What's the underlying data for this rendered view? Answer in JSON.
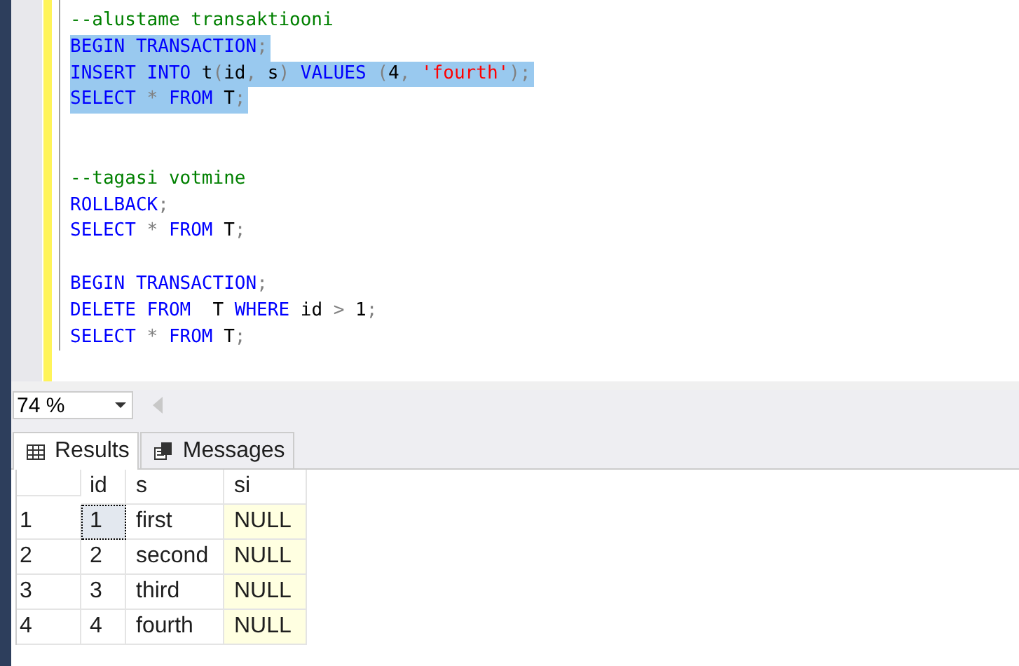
{
  "editor": {
    "lines": [
      {
        "selected": false,
        "tokens": [
          {
            "kind": "comment",
            "text": "--alustame transaktiooni"
          }
        ]
      },
      {
        "selected": true,
        "tokens": [
          {
            "kind": "keyword",
            "text": "BEGIN TRANSACTION"
          },
          {
            "kind": "operator",
            "text": ";"
          }
        ]
      },
      {
        "selected": true,
        "tokens": [
          {
            "kind": "keyword",
            "text": "INSERT INTO "
          },
          {
            "kind": "plain",
            "text": "t"
          },
          {
            "kind": "operator",
            "text": "("
          },
          {
            "kind": "plain",
            "text": "id"
          },
          {
            "kind": "operator",
            "text": ", "
          },
          {
            "kind": "plain",
            "text": "s"
          },
          {
            "kind": "operator",
            "text": ") "
          },
          {
            "kind": "keyword",
            "text": "VALUES "
          },
          {
            "kind": "operator",
            "text": "("
          },
          {
            "kind": "plain",
            "text": "4"
          },
          {
            "kind": "operator",
            "text": ", "
          },
          {
            "kind": "string",
            "text": "'fourth'"
          },
          {
            "kind": "operator",
            "text": ");"
          }
        ]
      },
      {
        "selected": true,
        "tokens": [
          {
            "kind": "keyword",
            "text": "SELECT "
          },
          {
            "kind": "operator",
            "text": "* "
          },
          {
            "kind": "keyword",
            "text": "FROM "
          },
          {
            "kind": "plain",
            "text": "T"
          },
          {
            "kind": "operator",
            "text": ";"
          }
        ]
      },
      {
        "selected": false
      },
      {
        "selected": false
      },
      {
        "selected": false,
        "tokens": [
          {
            "kind": "comment",
            "text": "--tagasi votmine"
          }
        ]
      },
      {
        "selected": false,
        "tokens": [
          {
            "kind": "keyword",
            "text": "ROLLBACK"
          },
          {
            "kind": "operator",
            "text": ";"
          }
        ]
      },
      {
        "selected": false,
        "tokens": [
          {
            "kind": "keyword",
            "text": "SELECT "
          },
          {
            "kind": "operator",
            "text": "* "
          },
          {
            "kind": "keyword",
            "text": "FROM "
          },
          {
            "kind": "plain",
            "text": "T"
          },
          {
            "kind": "operator",
            "text": ";"
          }
        ]
      },
      {
        "selected": false
      },
      {
        "selected": false,
        "tokens": [
          {
            "kind": "keyword",
            "text": "BEGIN TRANSACTION"
          },
          {
            "kind": "operator",
            "text": ";"
          }
        ]
      },
      {
        "selected": false,
        "tokens": [
          {
            "kind": "keyword",
            "text": "DELETE FROM  "
          },
          {
            "kind": "plain",
            "text": "T "
          },
          {
            "kind": "keyword",
            "text": "WHERE "
          },
          {
            "kind": "plain",
            "text": "id "
          },
          {
            "kind": "operator",
            "text": "> "
          },
          {
            "kind": "plain",
            "text": "1"
          },
          {
            "kind": "operator",
            "text": ";"
          }
        ]
      },
      {
        "selected": false,
        "tokens": [
          {
            "kind": "keyword",
            "text": "SELECT "
          },
          {
            "kind": "operator",
            "text": "* "
          },
          {
            "kind": "keyword",
            "text": "FROM "
          },
          {
            "kind": "plain",
            "text": "T"
          },
          {
            "kind": "operator",
            "text": ";"
          }
        ]
      }
    ]
  },
  "zoom": {
    "value": "74 %"
  },
  "tabs": [
    {
      "label": "Results",
      "selected": true,
      "kind": "grid"
    },
    {
      "label": "Messages",
      "selected": false,
      "kind": "messages"
    }
  ],
  "table": {
    "columns": [
      "id",
      "s",
      "si"
    ],
    "rows": [
      {
        "number": "1",
        "cells": [
          {
            "text": "1",
            "selected": true,
            "null": false
          },
          {
            "text": "first",
            "selected": false,
            "null": false
          },
          {
            "text": "NULL",
            "selected": false,
            "null": true
          }
        ]
      },
      {
        "number": "2",
        "cells": [
          {
            "text": "2",
            "selected": false,
            "null": false
          },
          {
            "text": "second",
            "selected": false,
            "null": false
          },
          {
            "text": "NULL",
            "selected": false,
            "null": true
          }
        ]
      },
      {
        "number": "3",
        "cells": [
          {
            "text": "3",
            "selected": false,
            "null": false
          },
          {
            "text": "third",
            "selected": false,
            "null": false
          },
          {
            "text": "NULL",
            "selected": false,
            "null": true
          }
        ]
      },
      {
        "number": "4",
        "cells": [
          {
            "text": "4",
            "selected": false,
            "null": false
          },
          {
            "text": "fourth",
            "selected": false,
            "null": false
          },
          {
            "text": "NULL",
            "selected": false,
            "null": true
          }
        ]
      }
    ]
  }
}
